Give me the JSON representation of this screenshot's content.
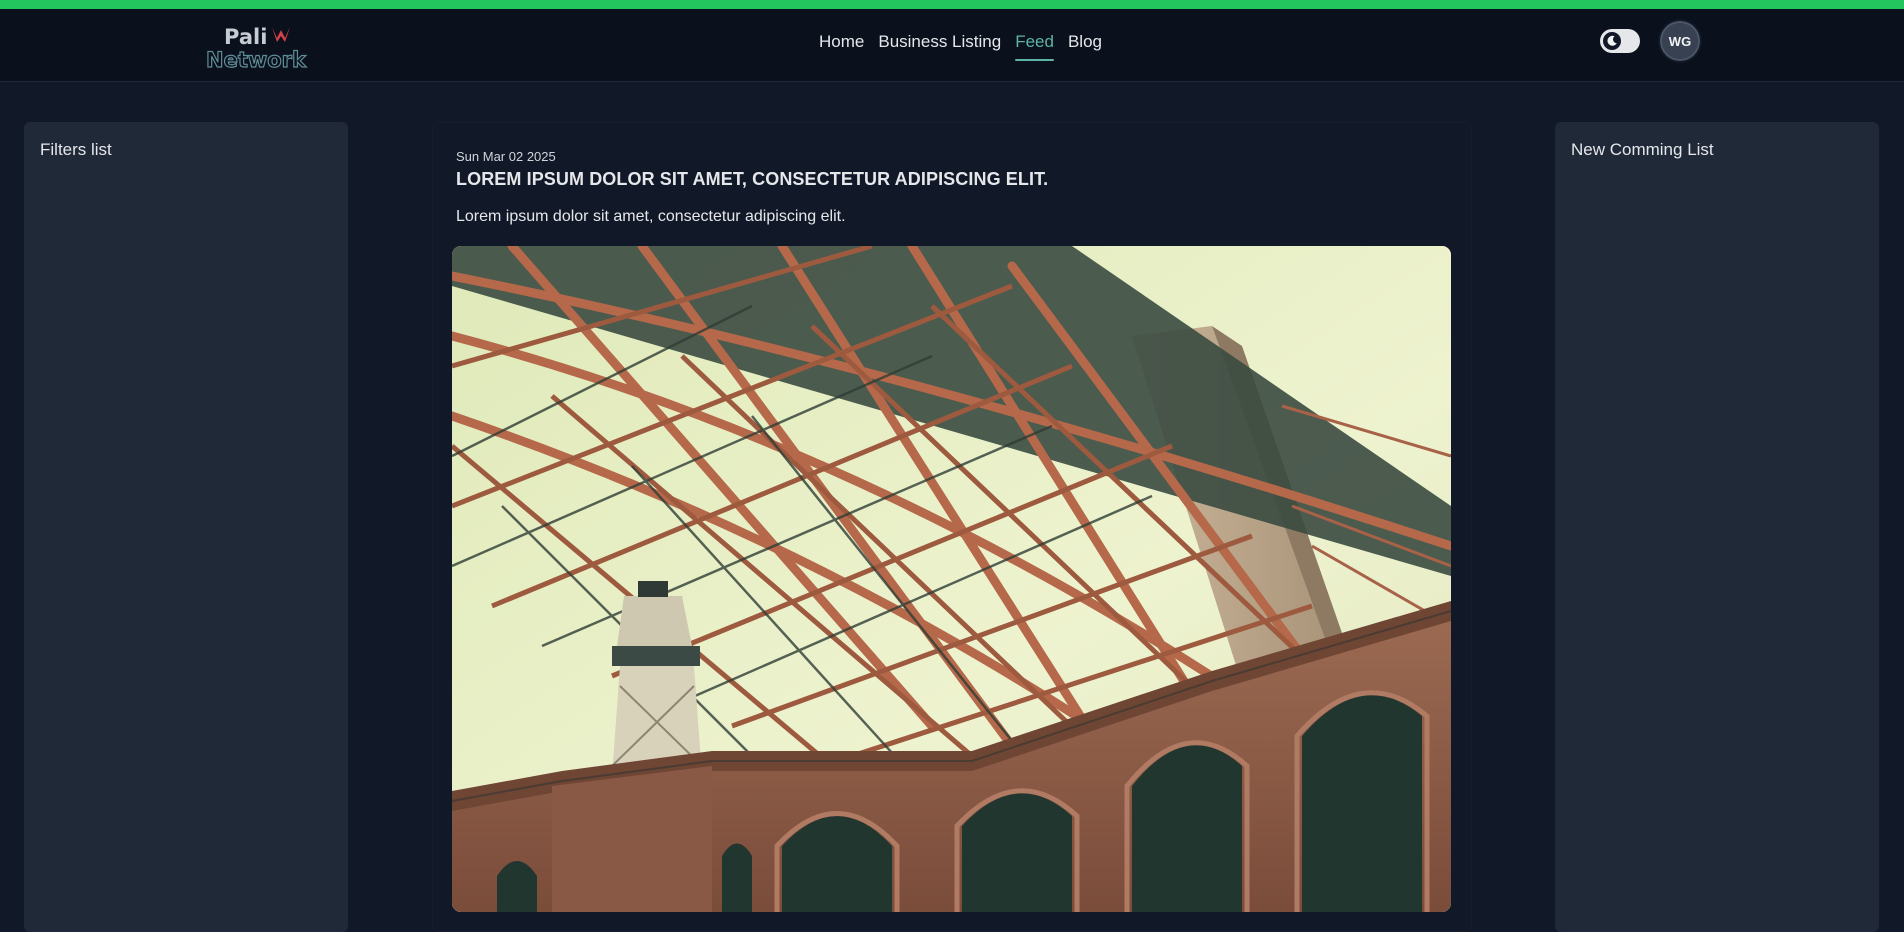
{
  "brand": {
    "logo_line1": "Pali",
    "logo_line2": "Network"
  },
  "nav": {
    "items": [
      {
        "label": "Home",
        "active": false
      },
      {
        "label": "Business Listing",
        "active": false
      },
      {
        "label": "Feed",
        "active": true
      },
      {
        "label": "Blog",
        "active": false
      }
    ]
  },
  "header": {
    "theme_toggle_icon": "moon-icon",
    "avatar_initials": "WG"
  },
  "left_panel": {
    "title": "Filters list"
  },
  "right_panel": {
    "title": "New Comming List"
  },
  "post": {
    "date": "Sun Mar 02 2025",
    "title": "LOREM IPSUM DOLOR SIT AMET, CONSECTETUR ADIPISCING ELIT.",
    "body": "Lorem ipsum dolor sit amet, consectetur adipiscing elit.",
    "image_subject": "steel-arch-bridge-over-brick-fort-photo"
  },
  "colors": {
    "accent_green": "#22c55e",
    "active_nav": "#5eb3a8",
    "page_bg": "#111827",
    "panel_bg": "#1f2937",
    "navbar_bg": "#0a101c"
  }
}
